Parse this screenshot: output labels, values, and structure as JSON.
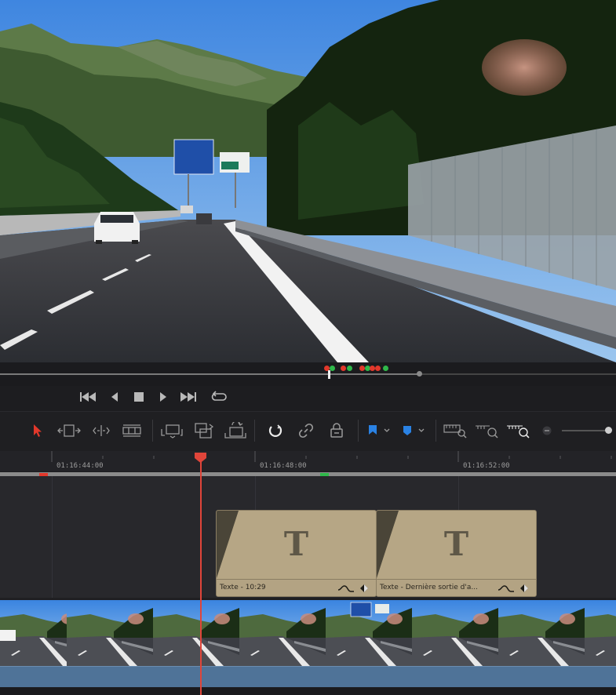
{
  "viewer": {
    "scene": "mountain highway dashcam frame"
  },
  "scrubber": {
    "markers": [
      "red",
      "green",
      "red",
      "green",
      "red",
      "green",
      "red",
      "red",
      "green"
    ],
    "colors": {
      "red": "#e2382b",
      "green": "#2fb84a"
    }
  },
  "transport": {
    "buttons": [
      "skip-to-start",
      "previous-frame",
      "stop",
      "play",
      "skip-to-end",
      "loop"
    ]
  },
  "toolbar": {
    "tools": [
      "selection-mode",
      "trim-edit-mode",
      "dynamic-trim-mode",
      "blade-edit-mode",
      "insert-clip",
      "overwrite-clip",
      "replace-clip",
      "snapping",
      "linked-selection",
      "position-lock",
      "flag",
      "marker",
      "full-extent-zoom",
      "detail-zoom",
      "custom-zoom"
    ],
    "accent": "#e2382b",
    "flag_color": "#2a82e4"
  },
  "ruler": {
    "timecodes": [
      "01:16:44:00",
      "01:16:48:00",
      "01:16:52:00"
    ]
  },
  "timeline": {
    "title_clips": [
      {
        "label": "Texte - 10:29"
      },
      {
        "label": "Texte - Dernière sortie d'a..."
      }
    ],
    "playhead_color": "#e0453a"
  }
}
